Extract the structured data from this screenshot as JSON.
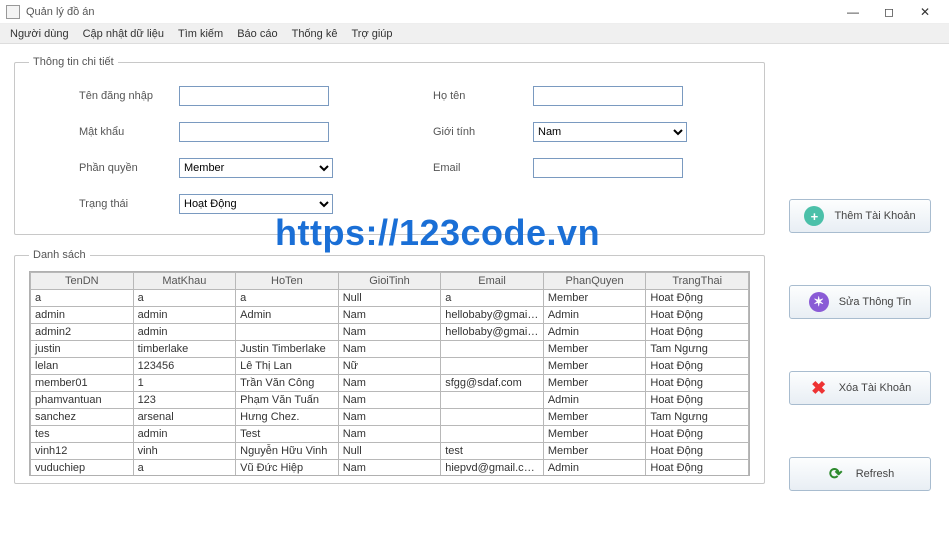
{
  "window": {
    "title": "Quản lý đồ án",
    "minimize": "—",
    "maximize": "◻",
    "close": "✕"
  },
  "menu": {
    "items": [
      "Người dùng",
      "Cập nhật dữ liệu",
      "Tìm kiếm",
      "Báo cáo",
      "Thống kê",
      "Trợ giúp"
    ]
  },
  "watermark": "https://123code.vn",
  "detail": {
    "legend": "Thông tin chi tiết",
    "labels": {
      "username": "Tên đăng nhập",
      "password": "Mật khẩu",
      "role": "Phần quyền",
      "status": "Trạng thái",
      "fullname": "Họ tên",
      "gender": "Giới tính",
      "email": "Email"
    },
    "values": {
      "username": "",
      "password": "",
      "role": "Member",
      "status": "Hoạt Động",
      "fullname": "",
      "gender": "Nam",
      "email": ""
    }
  },
  "list": {
    "legend": "Danh sách",
    "headers": [
      "TenDN",
      "MatKhau",
      "HoTen",
      "GioiTinh",
      "Email",
      "PhanQuyen",
      "TrangThai"
    ],
    "rows": [
      [
        "a",
        "a",
        "a",
        "Null",
        "a",
        "Member",
        "Hoat Động"
      ],
      [
        "admin",
        "admin",
        "Admin",
        "Nam",
        "hellobaby@gmail.com",
        "Admin",
        "Hoat Động"
      ],
      [
        "admin2",
        "admin",
        "",
        "Nam",
        "hellobaby@gmail.com",
        "Admin",
        "Hoat Động"
      ],
      [
        "justin",
        "timberlake",
        "Justin Timberlake",
        "Nam",
        "",
        "Member",
        "Tam Ngưng"
      ],
      [
        "lelan",
        "123456",
        "Lê Thị Lan",
        "Nữ",
        "",
        "Member",
        "Hoat Động"
      ],
      [
        "member01",
        "1",
        "Trần Văn Công",
        "Nam",
        "sfgg@sdaf.com",
        "Member",
        "Hoat Động"
      ],
      [
        "phamvantuan",
        "123",
        "Phạm Văn Tuấn",
        "Nam",
        "",
        "Admin",
        "Hoat Động"
      ],
      [
        "sanchez",
        "arsenal",
        "Hưng Chez.",
        "Nam",
        "",
        "Member",
        "Tam Ngưng"
      ],
      [
        "tes",
        "admin",
        "Test",
        "Nam",
        "",
        "Member",
        "Hoat Động"
      ],
      [
        "vinh12",
        "vinh",
        "Nguyễn Hữu Vinh",
        "Null",
        "test",
        "Member",
        "Hoat Động"
      ],
      [
        "vuduchiep",
        "a",
        "Vũ Đức Hiệp",
        "Nam",
        "hiepvd@gmail.com",
        "Admin",
        "Hoat Động"
      ]
    ]
  },
  "buttons": {
    "add": "Thêm Tài Khoản",
    "edit": "Sửa Thông Tin",
    "del": "Xóa Tài Khoản",
    "refresh": "Refresh"
  }
}
